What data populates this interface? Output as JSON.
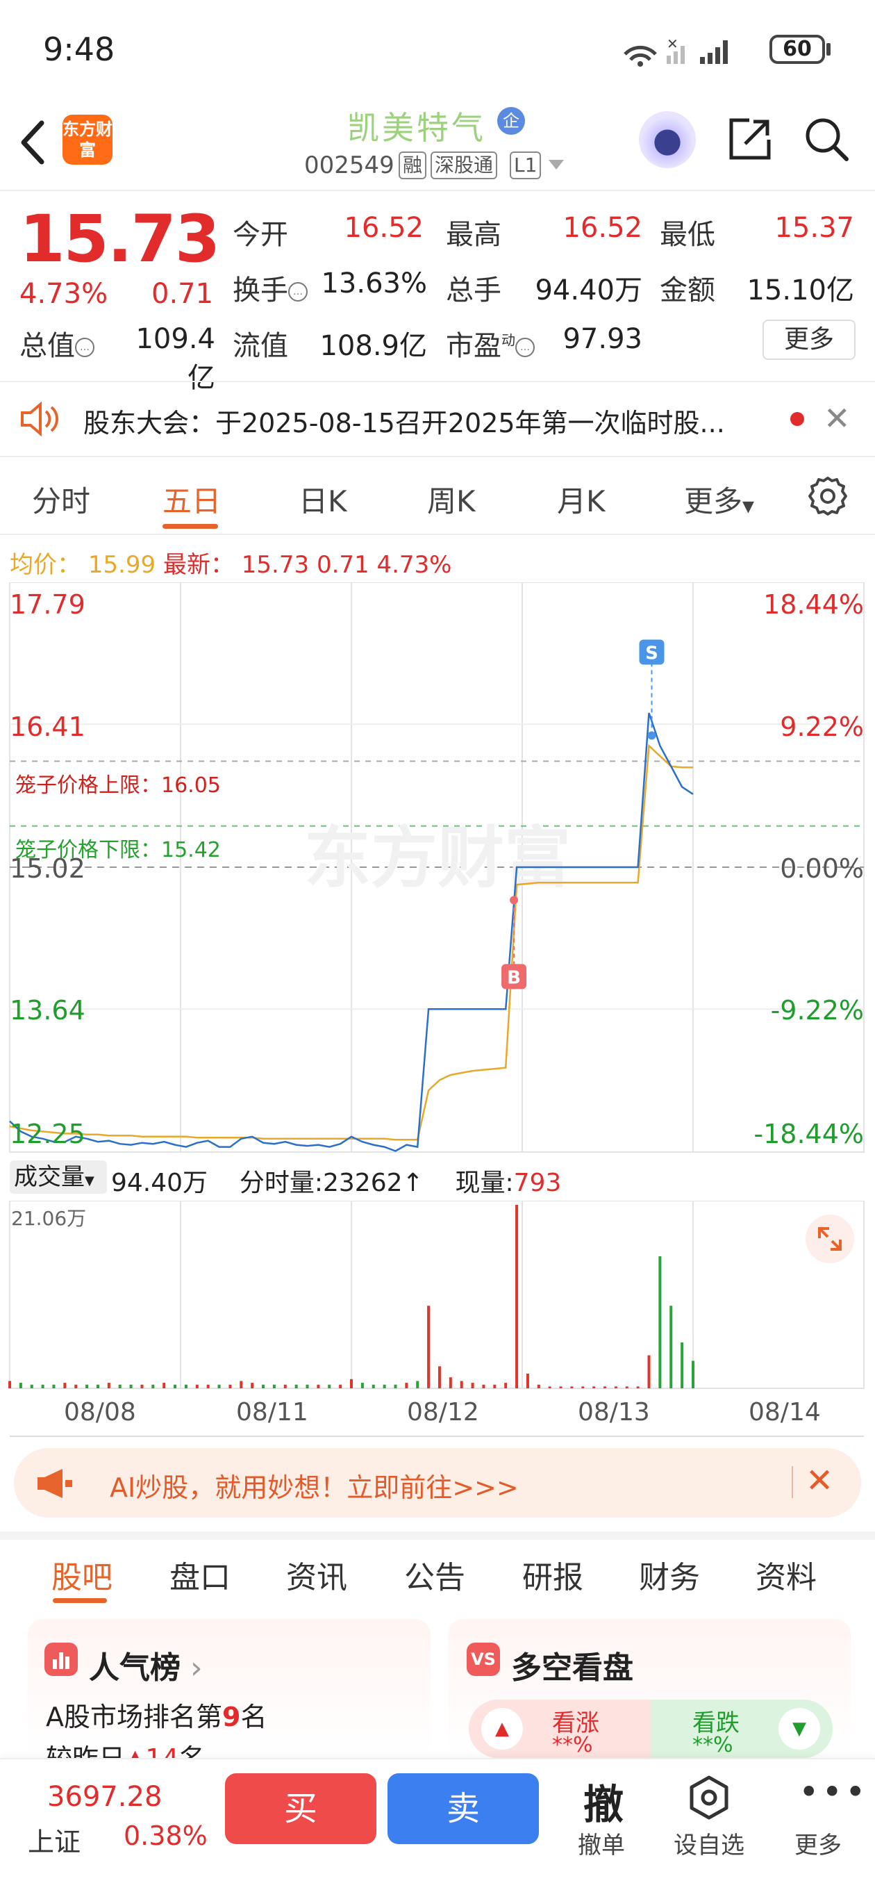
{
  "status": {
    "time": "9:48",
    "battery": "60"
  },
  "header": {
    "stock_name": "凯美特气",
    "qi_badge": "企",
    "app_logo": "东方财富",
    "code": "002549",
    "tags": [
      "融",
      "深股通",
      "L1"
    ]
  },
  "quote": {
    "price": "15.73",
    "pct": "4.73%",
    "change": "0.71",
    "items": [
      {
        "label": "今开",
        "value": "16.52",
        "color": "red"
      },
      {
        "label": "最高",
        "value": "16.52",
        "color": "red"
      },
      {
        "label": "最低",
        "value": "15.37",
        "color": "red"
      },
      {
        "label": "换手",
        "value": "13.63%",
        "color": "black"
      },
      {
        "label": "总手",
        "value": "94.40万",
        "color": "black"
      },
      {
        "label": "金额",
        "value": "15.10亿",
        "color": "black"
      },
      {
        "label": "总值",
        "value": "109.4亿",
        "color": "black"
      },
      {
        "label": "流值",
        "value": "108.9亿",
        "color": "black"
      },
      {
        "label": "市盈",
        "value": "97.93",
        "color": "black"
      }
    ],
    "pe_sup": "动",
    "more": "更多"
  },
  "notice": {
    "text": "股东大会：于2025-08-15召开2025年第一次临时股..."
  },
  "chart_tabs": [
    "分时",
    "五日",
    "日K",
    "周K",
    "月K",
    "更多"
  ],
  "active_tab": "五日",
  "avg_line": {
    "avg_label": "均价：",
    "avg_value": "15.99",
    "latest_label": "最新：",
    "latest_value": "15.73",
    "latest_change": "0.71",
    "latest_pct": "4.73%"
  },
  "chart_data": {
    "type": "line",
    "x_labels": [
      "08/08",
      "08/11",
      "08/12",
      "08/13",
      "08/14"
    ],
    "y_left_ticks": [
      "17.79",
      "16.41",
      "15.02",
      "13.64",
      "12.25"
    ],
    "y_right_ticks": [
      "18.44%",
      "9.22%",
      "0.00%",
      "-9.22%",
      "-18.44%"
    ],
    "ylim": [
      12.25,
      17.79
    ],
    "prev_close": 15.02,
    "price_series": [
      12.55,
      12.45,
      12.4,
      12.38,
      12.35,
      12.35,
      12.4,
      12.38,
      12.35,
      12.36,
      12.33,
      12.32,
      12.34,
      12.33,
      12.35,
      12.32,
      12.3,
      12.34,
      12.36,
      12.3,
      12.3,
      12.38,
      12.4,
      12.34,
      12.33,
      12.35,
      12.32,
      12.31,
      12.32,
      12.3,
      12.33,
      12.4,
      12.35,
      12.32,
      12.3,
      12.26,
      12.32,
      12.3,
      13.64,
      13.64,
      13.64,
      13.64,
      13.64,
      13.64,
      13.64,
      13.64,
      15.02,
      15.02,
      15.02,
      15.02,
      15.02,
      15.02,
      15.02,
      15.02,
      15.02,
      15.02,
      15.02,
      15.02,
      16.52,
      16.2,
      16.0,
      15.8,
      15.73
    ],
    "avg_series": [
      12.5,
      12.48,
      12.46,
      12.45,
      12.44,
      12.43,
      12.43,
      12.42,
      12.42,
      12.41,
      12.41,
      12.41,
      12.4,
      12.4,
      12.4,
      12.4,
      12.4,
      12.39,
      12.39,
      12.39,
      12.39,
      12.39,
      12.39,
      12.38,
      12.38,
      12.38,
      12.38,
      12.38,
      12.38,
      12.38,
      12.38,
      12.38,
      12.38,
      12.38,
      12.38,
      12.37,
      12.37,
      12.37,
      12.85,
      12.95,
      13.0,
      13.02,
      13.04,
      13.05,
      13.06,
      13.07,
      14.85,
      14.86,
      14.87,
      14.87,
      14.87,
      14.87,
      14.87,
      14.87,
      14.87,
      14.87,
      14.87,
      14.87,
      16.2,
      16.1,
      16.0,
      15.99,
      15.99
    ],
    "cage_upper": {
      "label": "笼子价格上限：",
      "value": "16.05"
    },
    "cage_lower": {
      "label": "笼子价格下限：",
      "value": "15.42"
    },
    "markers": [
      {
        "label": "B",
        "price": 14.7
      },
      {
        "label": "S",
        "price": 16.3
      }
    ],
    "watermark": "东方财富",
    "volume": {
      "max_label": "21.06万",
      "values": [
        0.04,
        0.03,
        0.02,
        0.02,
        0.02,
        0.03,
        0.02,
        0.02,
        0.02,
        0.03,
        0.02,
        0.02,
        0.02,
        0.02,
        0.03,
        0.02,
        0.02,
        0.02,
        0.02,
        0.02,
        0.02,
        0.04,
        0.03,
        0.02,
        0.02,
        0.02,
        0.02,
        0.02,
        0.02,
        0.02,
        0.02,
        0.05,
        0.03,
        0.02,
        0.02,
        0.02,
        0.03,
        0.04,
        0.45,
        0.12,
        0.06,
        0.04,
        0.03,
        0.02,
        0.02,
        0.03,
        1.0,
        0.08,
        0.02,
        0.01,
        0.01,
        0.01,
        0.01,
        0.01,
        0.01,
        0.01,
        0.01,
        0.01,
        0.18,
        0.72,
        0.45,
        0.25,
        0.15
      ]
    }
  },
  "volume_bar": {
    "select": "成交量",
    "total": "94.40万",
    "tick_label": "分时量:",
    "tick_value": "23262",
    "now_label": "现量:",
    "now_value": "793"
  },
  "ai_banner": {
    "text": "AI炒股，就用妙想！立即前往>>>"
  },
  "bottom_tabs": [
    "股吧",
    "盘口",
    "资讯",
    "公告",
    "研报",
    "财务",
    "资料"
  ],
  "cards": {
    "popularity": {
      "title": "人气榜",
      "rank_text": "A股市场排名第",
      "rank": "9",
      "rank_suffix": "名",
      "compare": "较昨日",
      "compare_value": "14",
      "compare_suffix": "名"
    },
    "bull_bear": {
      "title": "多空看盘",
      "bull": "看涨",
      "bear": "看跌",
      "bull_pct": "**%",
      "bear_pct": "**%"
    }
  },
  "bottom_bar": {
    "index_value": "3697.28",
    "index_name": "上证",
    "index_pct": "0.38%",
    "buy": "买",
    "sell": "卖",
    "cancel_big": "撤",
    "cancel": "撤单",
    "watch": "设自选",
    "more": "更多"
  }
}
